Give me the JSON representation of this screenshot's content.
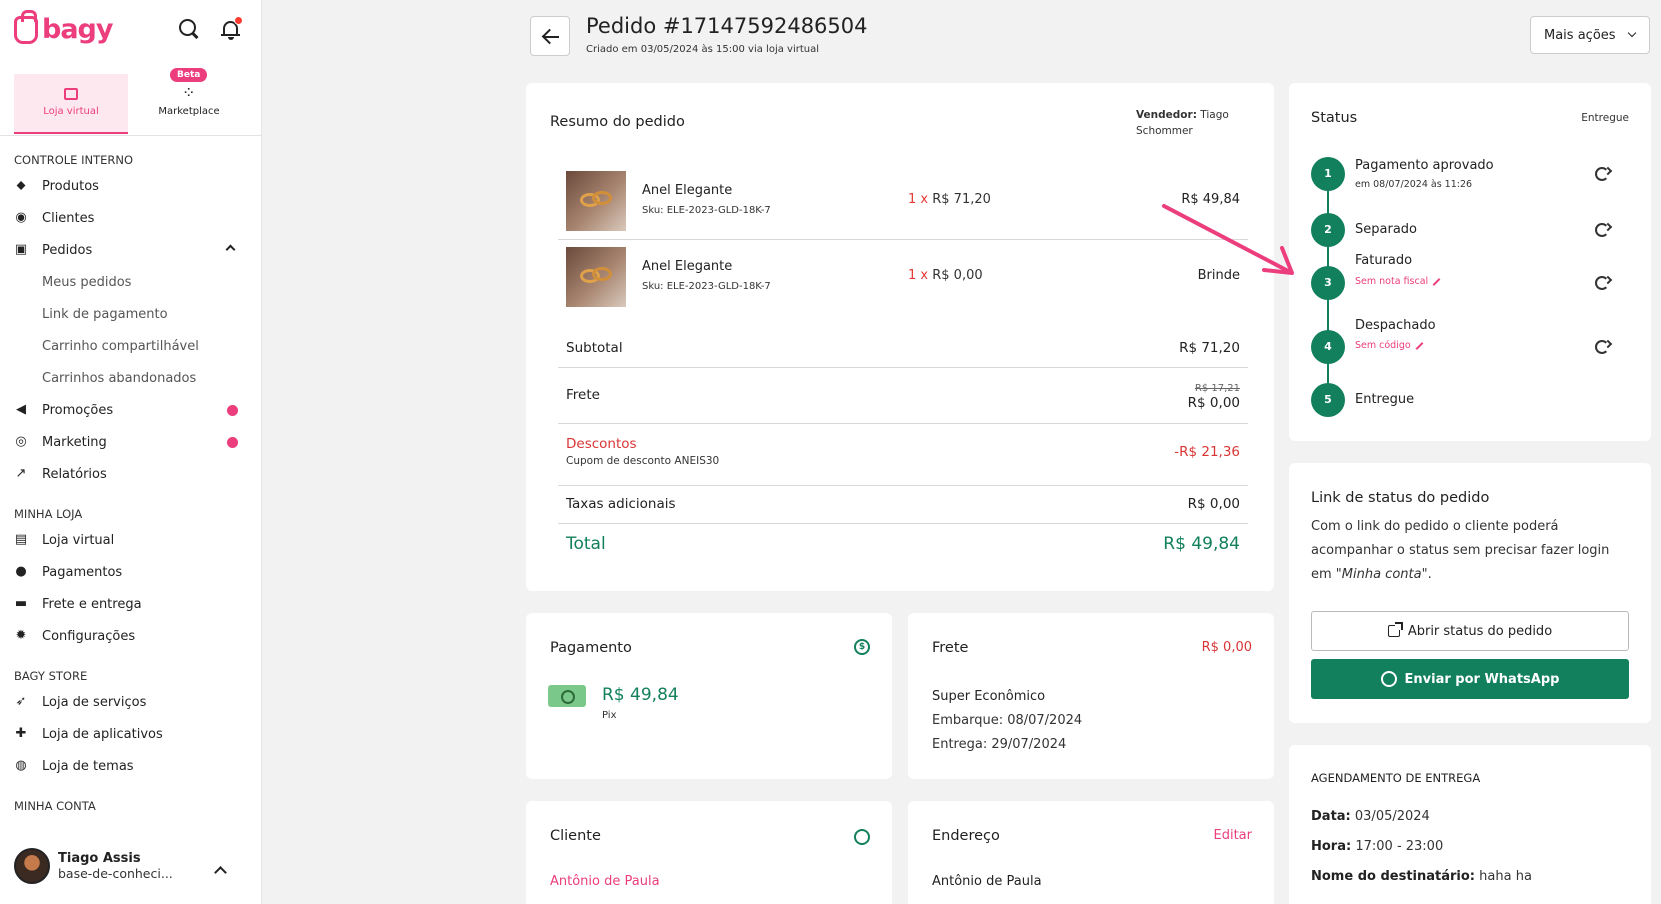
{
  "brand": {
    "name": "bagy",
    "accent": "#ec3d7d",
    "green": "#12805c"
  },
  "store_tabs": [
    {
      "label": "Loja virtual",
      "active": true
    },
    {
      "label": "Marketplace",
      "badge": "Beta"
    }
  ],
  "nav": {
    "sections": [
      {
        "title": "CONTROLE INTERNO",
        "items": [
          {
            "label": "Produtos",
            "icon": "tag-icon"
          },
          {
            "label": "Clientes",
            "icon": "user-circle-icon"
          },
          {
            "label": "Pedidos",
            "icon": "inbox-icon",
            "expanded": true,
            "children": [
              "Meus pedidos",
              "Link de pagamento",
              "Carrinho compartilhável",
              "Carrinhos abandonados"
            ]
          },
          {
            "label": "Promoções",
            "icon": "megaphone-icon",
            "dot": true
          },
          {
            "label": "Marketing",
            "icon": "target-icon",
            "dot": true
          },
          {
            "label": "Relatórios",
            "icon": "chart-line-icon"
          }
        ]
      },
      {
        "title": "MINHA LOJA",
        "items": [
          {
            "label": "Loja virtual",
            "icon": "storefront-icon"
          },
          {
            "label": "Pagamentos",
            "icon": "dollar-circle-icon"
          },
          {
            "label": "Frete e entrega",
            "icon": "truck-icon"
          },
          {
            "label": "Configurações",
            "icon": "gear-icon"
          }
        ]
      },
      {
        "title": "BAGY STORE",
        "items": [
          {
            "label": "Loja de serviços",
            "icon": "rocket-icon"
          },
          {
            "label": "Loja de aplicativos",
            "icon": "puzzle-icon"
          },
          {
            "label": "Loja de temas",
            "icon": "palette-icon"
          }
        ]
      },
      {
        "title": "MINHA CONTA",
        "items": []
      }
    ]
  },
  "account": {
    "name": "Tiago Assis",
    "subtitle": "base-de-conheci..."
  },
  "header": {
    "title": "Pedido #17147592486504",
    "subtitle": "Criado em 03/05/2024 às 15:00 via loja virtual",
    "more_actions": "Mais ações"
  },
  "summary": {
    "title": "Resumo do pedido",
    "seller_label": "Vendedor:",
    "seller_name": "Tiago Schommer",
    "products": [
      {
        "name": "Anel Elegante",
        "sku": "Sku: ELE-2023-GLD-18K-7",
        "qty": "1 x",
        "unit": "R$ 71,20",
        "total": "R$ 49,84"
      },
      {
        "name": "Anel Elegante",
        "sku": "Sku: ELE-2023-GLD-18K-7",
        "qty": "1 x",
        "unit": "R$ 0,00",
        "total": "Brinde"
      }
    ],
    "subtotal_label": "Subtotal",
    "subtotal": "R$ 71,20",
    "frete_label": "Frete",
    "frete_old": "R$ 17,21",
    "frete": "R$ 0,00",
    "discount_label": "Descontos",
    "coupon": "Cupom de desconto ANEIS30",
    "discount": "-R$ 21,36",
    "taxes_label": "Taxas adicionais",
    "taxes": "R$ 0,00",
    "total_label": "Total",
    "total": "R$ 49,84"
  },
  "status": {
    "title": "Status",
    "current": "Entregue",
    "steps": [
      {
        "n": "1",
        "label": "Pagamento aprovado",
        "meta": "em 08/07/2024 às 11:26"
      },
      {
        "n": "2",
        "label": "Separado"
      },
      {
        "n": "3",
        "label": "Faturado",
        "meta": "Sem nota fiscal"
      },
      {
        "n": "4",
        "label": "Despachado",
        "meta": "Sem código"
      },
      {
        "n": "5",
        "label": "Entregue"
      }
    ]
  },
  "status_link": {
    "title": "Link de status do pedido",
    "desc_1": "Com o link do pedido o cliente poderá acompanhar o status sem precisar fazer login em ",
    "desc_em": "\"Minha conta\"",
    "desc_2": ".",
    "open_button": "Abrir status do pedido",
    "whatsapp_button": "Enviar por WhatsApp"
  },
  "schedule": {
    "title": "AGENDAMENTO DE ENTREGA",
    "date_label": "Data:",
    "date": "03/05/2024",
    "time_label": "Hora:",
    "time": "17:00 - 23:00",
    "recipient_label": "Nome do destinatário:",
    "recipient": "haha ha"
  },
  "payment": {
    "title": "Pagamento",
    "value": "R$ 49,84",
    "method": "Pix"
  },
  "shipping": {
    "title": "Frete",
    "price": "R$ 0,00",
    "service": "Super Econômico",
    "embarque": "Embarque: 08/07/2024",
    "entrega": "Entrega: 29/07/2024"
  },
  "client": {
    "title": "Cliente",
    "name": "Antônio de Paula"
  },
  "address": {
    "title": "Endereço",
    "edit": "Editar",
    "name": "Antônio de Paula"
  }
}
